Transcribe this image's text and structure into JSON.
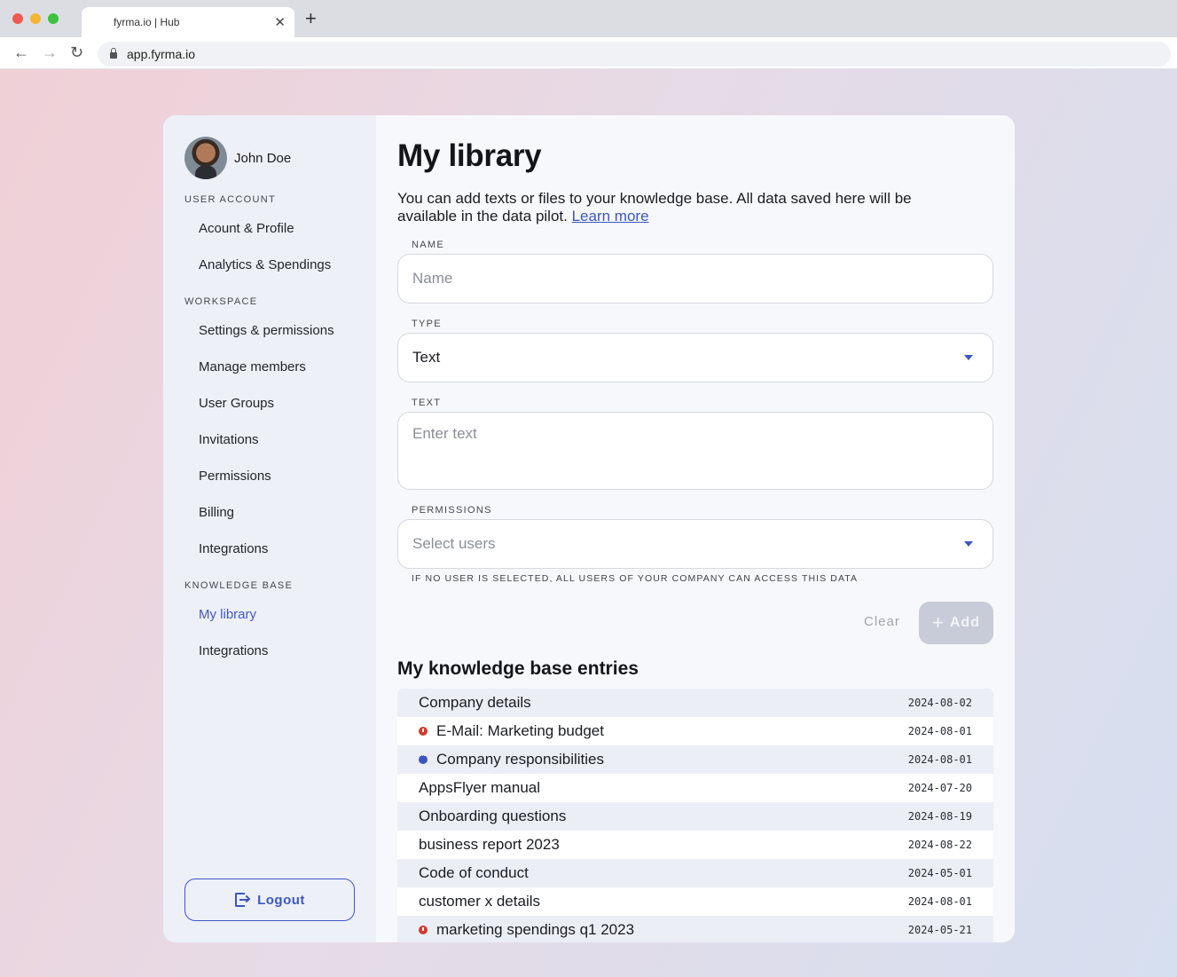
{
  "browser": {
    "tab_title": "fyrma.io | Hub",
    "tab_close": "✕",
    "new_tab": "+",
    "url": "app.fyrma.io",
    "back": "←",
    "forward": "→",
    "reload": "↻"
  },
  "sidebar": {
    "user_name": "John Doe",
    "sections": {
      "user_account": "USER ACCOUNT",
      "workspace": "WORKSPACE",
      "knowledge_base": "KNOWLEDGE BASE"
    },
    "items": [
      "Acount & Profile",
      "Analytics & Spendings",
      "Settings & permissions",
      "Manage members",
      "User Groups",
      "Invitations",
      "Permissions",
      "Billing",
      "Integrations",
      "My library",
      "Integrations"
    ],
    "active_item": "My library",
    "logout_label": "Logout"
  },
  "main": {
    "title": "My library",
    "intro": "You can add texts or files to your knowledge base. All data saved here will be available in the data pilot.",
    "learn_more": "Learn more",
    "form": {
      "name_label": "NAME",
      "name_placeholder": "Name",
      "type_label": "TYPE",
      "type_value": "Text",
      "text_label": "TEXT",
      "text_placeholder": "Enter text",
      "permissions_label": "PERMISSIONS",
      "permissions_placeholder": "Select users",
      "hint": "IF NO USER IS SELECTED, ALL USERS OF YOUR COMPANY CAN ACCESS THIS DATA",
      "clear_label": "Clear",
      "add_label": "Add"
    },
    "entries_title": "My knowledge base entries",
    "entries": [
      {
        "name": "Company details",
        "date": "2024-08-02",
        "status": ""
      },
      {
        "name": "E-Mail: Marketing budget",
        "date": "2024-08-01",
        "status": "error"
      },
      {
        "name": "Company responsibilities",
        "date": "2024-08-01",
        "status": "pending"
      },
      {
        "name": "AppsFlyer manual",
        "date": "2024-07-20",
        "status": ""
      },
      {
        "name": "Onboarding questions",
        "date": "2024-08-19",
        "status": ""
      },
      {
        "name": "business report 2023",
        "date": "2024-08-22",
        "status": ""
      },
      {
        "name": "Code of conduct",
        "date": "2024-05-01",
        "status": ""
      },
      {
        "name": "customer x details",
        "date": "2024-08-01",
        "status": ""
      },
      {
        "name": "marketing spendings q1 2023",
        "date": "2024-05-21",
        "status": "error"
      }
    ]
  },
  "colors": {
    "accent": "#3b55c4",
    "error": "#d33a2c",
    "sidebar_bg": "#eef0f8"
  }
}
